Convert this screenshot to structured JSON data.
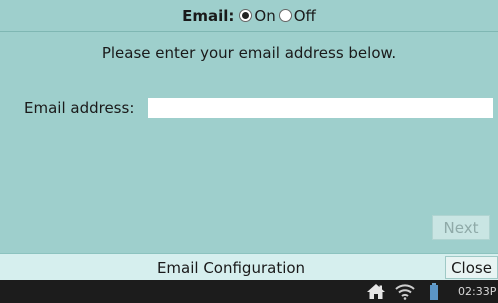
{
  "header": {
    "label": "Email:",
    "options": [
      {
        "label": "On",
        "checked": true
      },
      {
        "label": "Off",
        "checked": false
      }
    ]
  },
  "instructions": "Please enter your email address below.",
  "form": {
    "email_label": "Email address:",
    "email_value": ""
  },
  "next_label": "Next",
  "bottom_bar": {
    "title": "Email Configuration",
    "close_label": "Close"
  },
  "status_bar": {
    "time": "02:33P",
    "icons": [
      "home-icon",
      "wifi-icon",
      "battery-icon"
    ]
  }
}
